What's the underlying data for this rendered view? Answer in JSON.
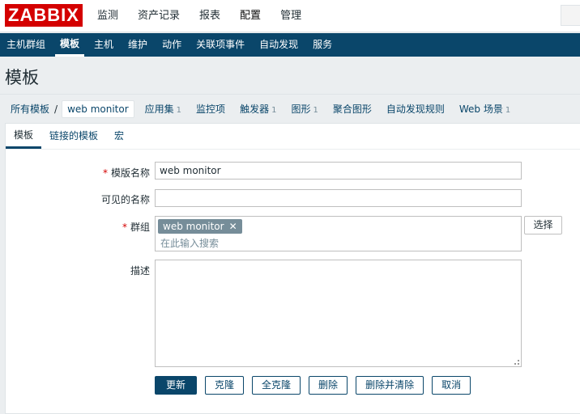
{
  "logo": "ZABBIX",
  "top_menu": [
    "监测",
    "资产记录",
    "报表",
    "配置",
    "管理"
  ],
  "sub_menu": [
    "主机群组",
    "模板",
    "主机",
    "维护",
    "动作",
    "关联项事件",
    "自动发现",
    "服务"
  ],
  "page_title": "模板",
  "breadcrumb": {
    "all": "所有模板",
    "sep": "/",
    "current": "web monitor",
    "items": [
      {
        "label": "应用集",
        "count": "1"
      },
      {
        "label": "监控项",
        "count": ""
      },
      {
        "label": "触发器",
        "count": "1"
      },
      {
        "label": "图形",
        "count": "1"
      },
      {
        "label": "聚合图形",
        "count": ""
      },
      {
        "label": "自动发现规则",
        "count": ""
      },
      {
        "label": "Web 场景",
        "count": "1"
      }
    ]
  },
  "tabs": [
    "模板",
    "链接的模板",
    "宏"
  ],
  "form": {
    "template_name_label": "模版名称",
    "template_name_value": "web monitor",
    "visible_name_label": "可见的名称",
    "visible_name_value": "",
    "group_label": "群组",
    "group_tag": "web monitor",
    "group_placeholder": "在此输入搜索",
    "select_button": "选择",
    "description_label": "描述",
    "description_value": "",
    "required_mark": "*"
  },
  "buttons": [
    "更新",
    "克隆",
    "全克隆",
    "删除",
    "删除并清除",
    "取消"
  ],
  "colors": {
    "brand": "#d40000",
    "nav": "#0a466a",
    "tag": "#768d99"
  }
}
